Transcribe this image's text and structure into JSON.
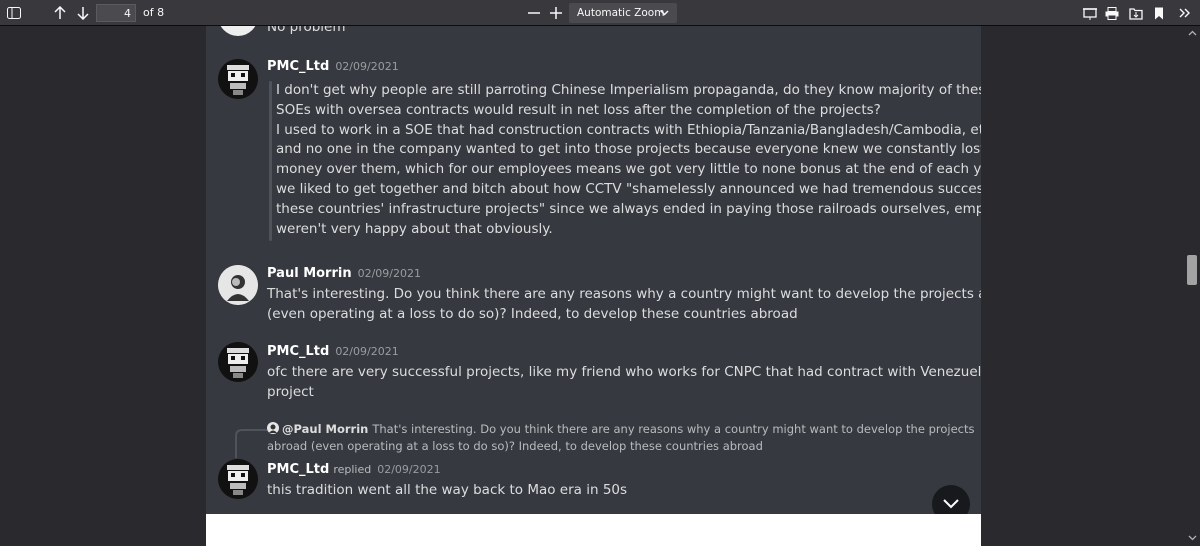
{
  "toolbar": {
    "page_value": "4",
    "page_count": "of 8",
    "zoom": "Automatic Zoom",
    "icons": [
      "sidebar-toggle-icon",
      "arrow-up-icon",
      "arrow-down-icon",
      "zoom-out-icon",
      "zoom-in-icon",
      "chevron-down-icon",
      "presentation-icon",
      "print-icon",
      "save-icon",
      "bookmark-icon",
      "tools-icon"
    ]
  },
  "colors": {
    "toolbar_bg": "#38383d",
    "viewer_bg": "#2a2a2e",
    "page_bg": "#36393f",
    "text": "#dcddde",
    "timestamp": "#9a9ca0"
  },
  "messages": {
    "m0": {
      "lines": [
        "No problem"
      ]
    },
    "m1": {
      "author": "PMC_Ltd",
      "timestamp": "02/09/2021",
      "quote_lines": [
        "I don't get why people are still parroting Chinese Imperialism propaganda, do they know majority of these",
        "SOEs with oversea contracts would result in net loss after the completion of the projects?",
        "I used to work in a SOE that had construction contracts with Ethiopia/Tanzania/Bangladesh/Cambodia, etc,",
        "and no one in the company wanted to get into those projects because everyone knew we constantly lost",
        "money over them, which for our employees means we got very little to none bonus at the end of each year",
        "we liked to get together and bitch about how CCTV \"shamelessly announced we had tremendous success with",
        "these countries' infrastructure projects\" since we always ended in paying those railroads ourselves, employees",
        "weren't very happy about that obviously."
      ]
    },
    "m2": {
      "author": "Paul Morrin",
      "timestamp": "02/09/2021",
      "lines": [
        "That's interesting. Do you think there are any reasons why a country might want to develop the projects abroad",
        "(even operating at a loss to do so)? Indeed, to develop these countries abroad"
      ]
    },
    "m3": {
      "author": "PMC_Ltd",
      "timestamp": "02/09/2021",
      "lines": [
        "ofc there are very successful projects, like my friend who works for CNPC that had contract with Venezuela oil",
        "project"
      ]
    },
    "m4": {
      "reply_author": "@Paul Morrin",
      "reply_lines": [
        "That's interesting. Do you think there are any reasons why a country might want to develop the projects",
        "abroad (even operating at a loss to do so)? Indeed, to develop these countries abroad"
      ],
      "author": "PMC_Ltd",
      "replied": "replied",
      "timestamp": "02/09/2021",
      "lines": [
        "this tradition went all the way back to Mao era in 50s"
      ]
    }
  }
}
